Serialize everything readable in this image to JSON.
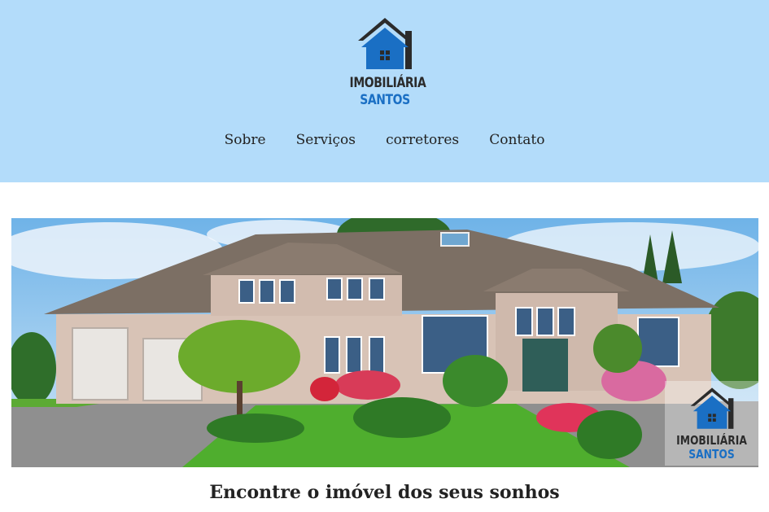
{
  "header": {
    "logo": {
      "icon": "house-logo-icon",
      "line1": "IMOBILIÁRIA",
      "line2": "SANTOS"
    }
  },
  "nav": {
    "items": [
      {
        "label": "Sobre"
      },
      {
        "label": "Serviços"
      },
      {
        "label": "corretores"
      },
      {
        "label": "Contato"
      }
    ]
  },
  "hero": {
    "watermark": {
      "line1": "IMOBILIÁRIA",
      "line2": "SANTOS"
    }
  },
  "tagline": "Encontre o imóvel dos seus sonhos",
  "colors": {
    "header_bg": "#b3dcfa",
    "brand_blue": "#1a6fc4",
    "brand_dark": "#2b2b2b"
  }
}
